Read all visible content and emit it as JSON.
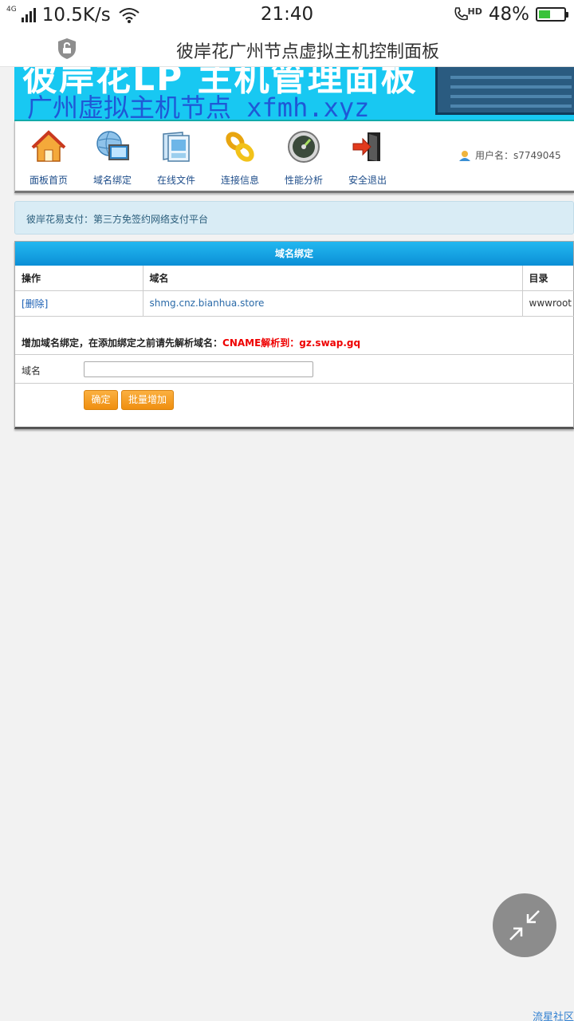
{
  "status_bar": {
    "network_type": "4G",
    "speed": "10.5K/s",
    "time": "21:40",
    "call_label": "HD",
    "battery_percent": "48%",
    "battery_level": 0.48
  },
  "title_bar": {
    "title": "彼岸花广州节点虚拟主机控制面板"
  },
  "banner": {
    "headline": "彼岸花LP 主机管理面板",
    "subtitle": "广州虚拟主机节点 xfmh.xyz"
  },
  "toolbar": {
    "items": [
      {
        "label": "面板首页",
        "icon": "home-icon"
      },
      {
        "label": "域名绑定",
        "icon": "globe-monitor-icon"
      },
      {
        "label": "在线文件",
        "icon": "file-manager-icon"
      },
      {
        "label": "连接信息",
        "icon": "chain-link-icon"
      },
      {
        "label": "性能分析",
        "icon": "gauge-icon"
      },
      {
        "label": "安全退出",
        "icon": "exit-door-icon"
      }
    ],
    "user_label": "用户名：s7749045"
  },
  "notice": {
    "text": "彼岸花易支付：第三方免签约网络支付平台"
  },
  "domain_panel": {
    "title": "域名绑定",
    "columns": [
      "操作",
      "域名",
      "目录"
    ],
    "rows": [
      {
        "action": "[删除]",
        "domain": "shmg.cnz.bianhua.store",
        "directory": "wwwroot"
      }
    ],
    "hint_prefix": "增加域名绑定，在添加绑定之前请先解析域名：",
    "hint_cname": "CNAME解析到：gz.swap.gq",
    "field_label": "域名",
    "field_value": "",
    "confirm_button": "确定",
    "batch_button": "批量增加"
  },
  "corner_text": "流星社区",
  "colors": {
    "panel_header": "#0b8fd6",
    "banner": "#18c8f2",
    "button": "#ef8f10",
    "cname_hint": "#e00000"
  }
}
